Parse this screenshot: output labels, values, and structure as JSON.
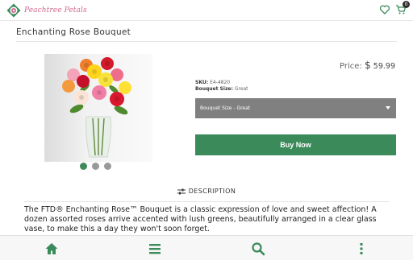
{
  "header": {
    "logo_text": "Peachtree Petals",
    "cart_count": "0",
    "icons": {
      "wishlist": "heart-icon",
      "cart": "cart-icon"
    }
  },
  "product": {
    "title": "Enchanting Rose Bouquet",
    "price_label": "Price:",
    "currency": "$",
    "price": "59.99",
    "sku_label": "SKU:",
    "sku": "E4-4820",
    "size_label": "Bouquet Size:",
    "size": "Great",
    "select_value": "Bouquet Size - Great",
    "buy_label": "Buy Now",
    "image_count": 3,
    "active_image": 1
  },
  "description": {
    "tab_label": "DESCRIPTION",
    "text": "The FTD® Enchanting Rose™ Bouquet is a classic expression of love and sweet affection! A dozen assorted roses arrive accented with lush greens, beautifully arranged in a clear glass vase, to make this a day they won't soon forget."
  },
  "bottom_nav": [
    {
      "name": "home",
      "icon": "home-icon"
    },
    {
      "name": "menu",
      "icon": "menu-icon"
    },
    {
      "name": "search",
      "icon": "search-icon"
    },
    {
      "name": "more",
      "icon": "more-vertical-icon"
    }
  ],
  "colors": {
    "brand_green": "#3a8a5a",
    "brand_pink": "#d2678f",
    "select_gray": "#808080"
  }
}
